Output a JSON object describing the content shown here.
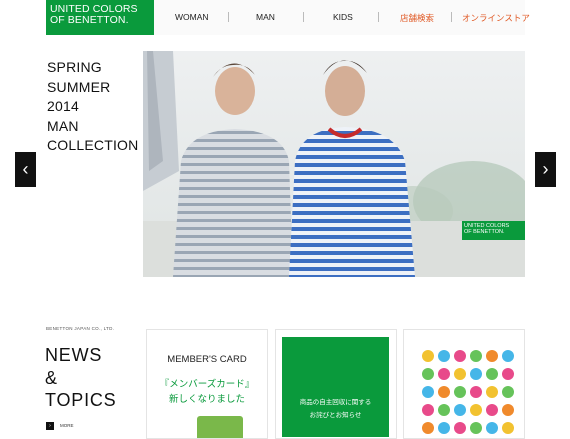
{
  "header": {
    "logo_line1": "UNITED COLORS",
    "logo_line2": "OF BENETTON.",
    "nav": [
      {
        "label": "WOMAN"
      },
      {
        "label": "MAN"
      },
      {
        "label": "KIDS"
      },
      {
        "label": "店舗検索"
      },
      {
        "label": "オンラインストア"
      }
    ]
  },
  "hero": {
    "lines": [
      "SPRING",
      "SUMMER",
      "2014",
      "MAN",
      "COLLECTION"
    ],
    "prev_icon": "chevron-left-icon",
    "next_icon": "chevron-right-icon",
    "badge_line1": "UNITED COLORS",
    "badge_line2": "OF BENETTON."
  },
  "news": {
    "company": "BENETTON JAPAN CO., LTD.",
    "title_line1": "NEWS",
    "title_line2": "&",
    "title_line3": "TOPICS",
    "more_label": "MORE"
  },
  "cards": {
    "member_title": "MEMBER'S CARD",
    "member_jp1": "『メンバーズカード』",
    "member_jp2": "新しくなりました",
    "recall_line1": "商品の自主回収に関する",
    "recall_line2": "お詫びとお知らせ"
  },
  "colors": {
    "brand_green": "#0a9a3c",
    "nav_accent": "#e05a26"
  }
}
